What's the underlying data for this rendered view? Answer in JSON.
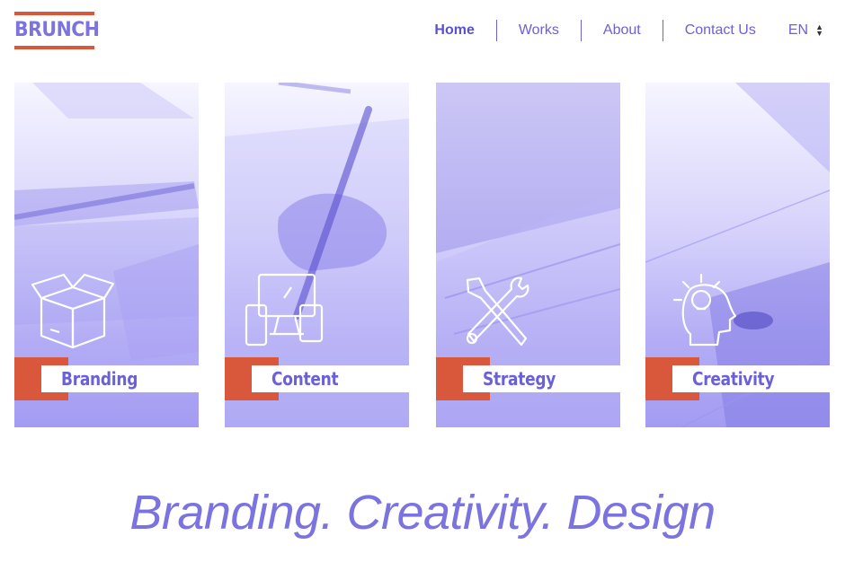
{
  "brand": {
    "logo_text": "BRUNCH"
  },
  "nav": {
    "items": [
      {
        "label": "Home",
        "active": true
      },
      {
        "label": "Works"
      },
      {
        "label": "About"
      },
      {
        "label": "Contact Us"
      }
    ],
    "language": "EN"
  },
  "cards": [
    {
      "label": "Branding",
      "icon": "box-icon"
    },
    {
      "label": "Content",
      "icon": "devices-icon"
    },
    {
      "label": "Strategy",
      "icon": "tools-icon"
    },
    {
      "label": "Creativity",
      "icon": "idea-head-icon"
    }
  ],
  "tagline": "Branding. Creativity. Design",
  "colors": {
    "accent": "#d9583b",
    "brand": "#6a60d8",
    "tint": "#a49cf2"
  }
}
